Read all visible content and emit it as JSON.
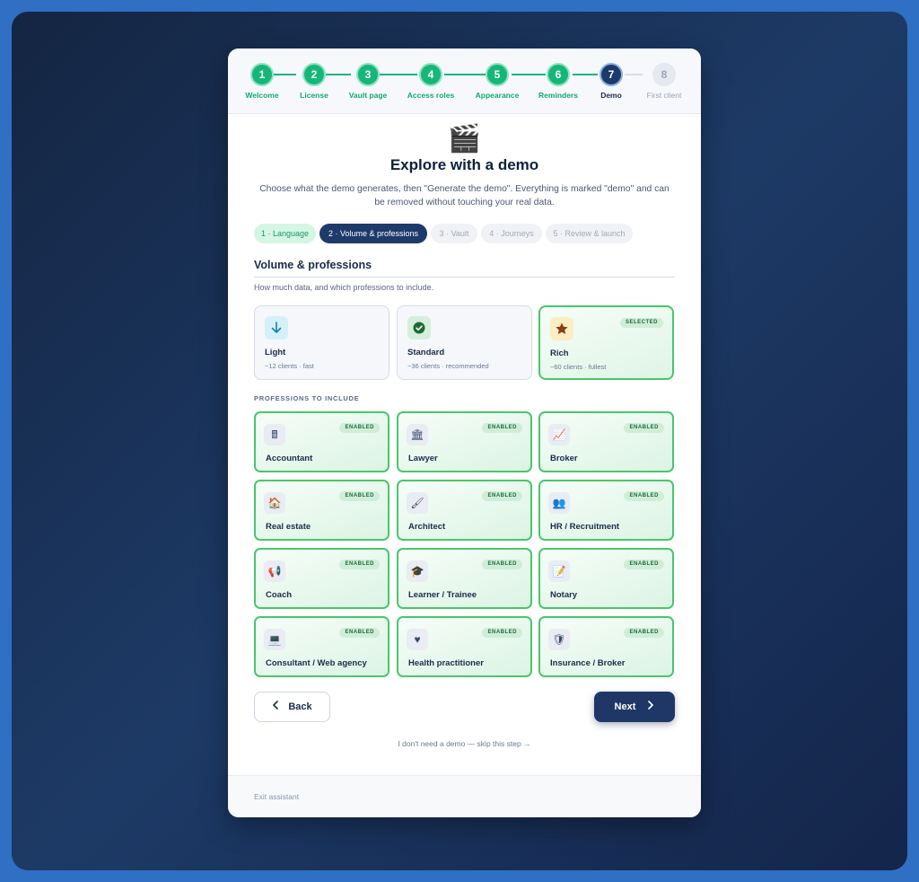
{
  "stepper": {
    "steps": [
      {
        "num": "1",
        "label": "Welcome",
        "state": "done"
      },
      {
        "num": "2",
        "label": "License",
        "state": "done"
      },
      {
        "num": "3",
        "label": "Vault page",
        "state": "done"
      },
      {
        "num": "4",
        "label": "Access roles",
        "state": "done"
      },
      {
        "num": "5",
        "label": "Appearance",
        "state": "done"
      },
      {
        "num": "6",
        "label": "Reminders",
        "state": "done"
      },
      {
        "num": "7",
        "label": "Demo",
        "state": "current"
      },
      {
        "num": "8",
        "label": "First client",
        "state": "todo"
      }
    ]
  },
  "hero": {
    "emoji": "🎬",
    "title": "Explore with a demo",
    "description": "Choose what the demo generates, then \"Generate the demo\". Everything is marked \"demo\" and can be removed without touching your real data."
  },
  "substeps": [
    {
      "label": "1 · Language",
      "state": "done"
    },
    {
      "label": "2 · Volume & professions",
      "state": "active"
    },
    {
      "label": "3 · Vault",
      "state": "todo"
    },
    {
      "label": "4 · Journeys",
      "state": "todo"
    },
    {
      "label": "5 · Review & launch",
      "state": "todo"
    }
  ],
  "section": {
    "title": "Volume & professions",
    "subtitle": "How much data, and which professions to include."
  },
  "volumes": [
    {
      "name": "Light",
      "desc": "~12 clients · fast",
      "icon": "arrow-down-icon",
      "selected": false
    },
    {
      "name": "Standard",
      "desc": "~36 clients · recommended",
      "icon": "check-circle-icon",
      "selected": false
    },
    {
      "name": "Rich",
      "desc": "~60 clients · fullest",
      "icon": "star-icon",
      "selected": true,
      "badge": "SELECTED"
    }
  ],
  "professions_label": "PROFESSIONS TO INCLUDE",
  "enabled_badge": "ENABLED",
  "professions": [
    {
      "name": "Accountant",
      "icon": "calculator-icon",
      "glyph": "🖩"
    },
    {
      "name": "Lawyer",
      "icon": "courthouse-icon",
      "glyph": "🏛"
    },
    {
      "name": "Broker",
      "icon": "chart-icon",
      "glyph": "📈"
    },
    {
      "name": "Real estate",
      "icon": "house-icon",
      "glyph": "🏠"
    },
    {
      "name": "Architect",
      "icon": "brush-icon",
      "glyph": "🖌"
    },
    {
      "name": "HR / Recruitment",
      "icon": "people-icon",
      "glyph": "👥"
    },
    {
      "name": "Coach",
      "icon": "megaphone-icon",
      "glyph": "📢"
    },
    {
      "name": "Learner / Trainee",
      "icon": "graduation-cap-icon",
      "glyph": "🎓"
    },
    {
      "name": "Notary",
      "icon": "document-pen-icon",
      "glyph": "📝"
    },
    {
      "name": "Consultant / Web agency",
      "icon": "laptop-icon",
      "glyph": "💻"
    },
    {
      "name": "Health practitioner",
      "icon": "heart-icon",
      "glyph": "♥"
    },
    {
      "name": "Insurance / Broker",
      "icon": "shield-icon",
      "glyph": "🛡"
    }
  ],
  "actions": {
    "back": "Back",
    "next": "Next",
    "skip": "I don't need a demo — skip this step →"
  },
  "footer": {
    "exit": "Exit assistant"
  },
  "colors": {
    "accent": "#1e3766",
    "success": "#16b67a",
    "selected_border": "#48c76c"
  }
}
